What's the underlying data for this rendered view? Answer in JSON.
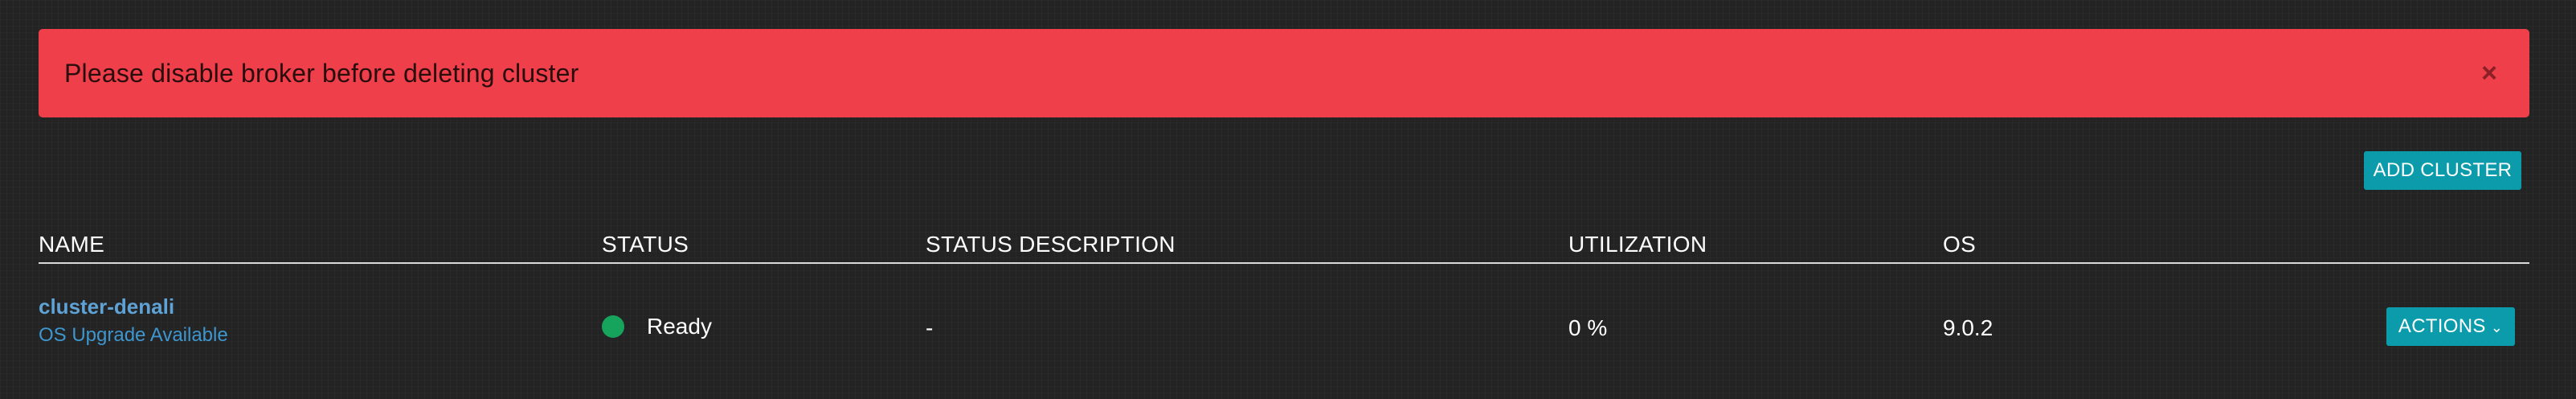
{
  "alert": {
    "message": "Please disable broker before deleting cluster",
    "close_glyph": "×",
    "background_color": "#ee3f4a"
  },
  "toolbar": {
    "add_cluster_label": "ADD CLUSTER",
    "button_color": "#0c9bab"
  },
  "table": {
    "headers": {
      "name": "NAME",
      "status": "STATUS",
      "status_description": "STATUS DESCRIPTION",
      "utilization": "UTILIZATION",
      "os": "OS"
    },
    "rows": [
      {
        "name": "cluster-denali",
        "upgrade_notice": "OS Upgrade Available",
        "status": "Ready",
        "status_color": "#16a35c",
        "status_description": "-",
        "utilization": "0 %",
        "os": "9.0.2",
        "actions_label": "ACTIONS",
        "actions_icon": "chevron-down-icon"
      }
    ]
  }
}
